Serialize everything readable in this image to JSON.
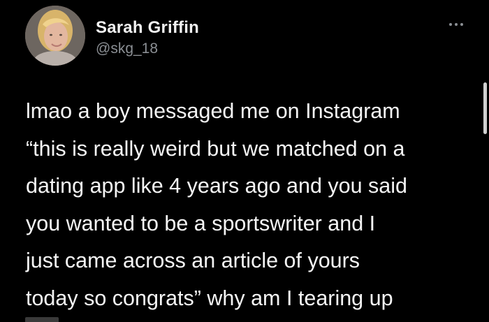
{
  "tweet": {
    "author": {
      "display_name": "Sarah Griffin",
      "handle": "@skg_18",
      "avatar_icon": "profile-photo"
    },
    "more_icon": "more-horizontal-icon",
    "text": "lmao a boy messaged me on Instagram\n“this is really weird but we matched on a\ndating app like 4 years ago and you said\nyou wanted to be a sportswriter and I\njust came across an article of yours\ntoday so congrats” why am I tearing up"
  },
  "colors": {
    "background": "#000000",
    "name_text": "#f2f2f2",
    "handle_text": "#8b8f94",
    "body_text": "#f5f5f5"
  }
}
